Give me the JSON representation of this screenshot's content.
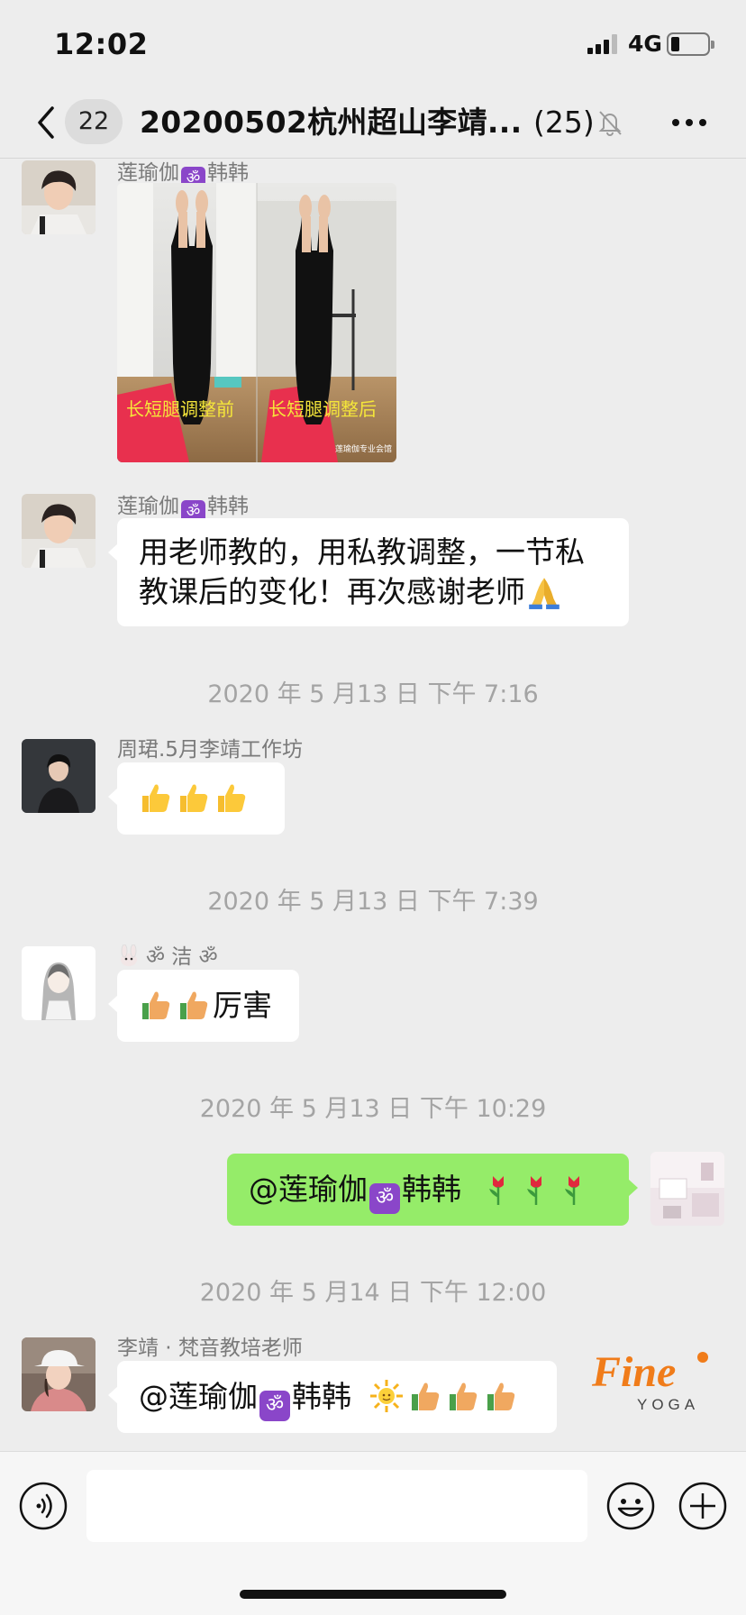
{
  "status_bar": {
    "time": "12:02",
    "network": "4G",
    "battery_level": 0.15
  },
  "nav": {
    "back_icon": "chevron-left-icon",
    "unread_count": "22",
    "title": "20200502杭州超山李靖...",
    "member_count": "(25)",
    "mute_icon": "bell-slash-icon",
    "more_icon": "ellipsis-icon"
  },
  "messages": [
    {
      "sender": "莲瑜伽 ☸ 韩韩",
      "sender_name_pre": "莲瑜伽",
      "sender_name_post": "韩韩",
      "type": "image",
      "image_caption_left": "长短腿调整前",
      "image_caption_right": "长短腿调整后",
      "image_watermark": "莲瑜伽专业会馆"
    },
    {
      "sender_name_pre": "莲瑜伽",
      "sender_name_post": "韩韩",
      "type": "text",
      "text_line1": "用老师教的，用私教调整，一节私",
      "text_line2": "教课后的变化！再次感谢老师"
    },
    {
      "timestamp": "2020 年 5 月13 日  下午 7:16"
    },
    {
      "sender": "周珺.5月李靖工作坊",
      "type": "text",
      "emoji": [
        "thumbs-up-icon",
        "thumbs-up-icon",
        "thumbs-up-icon"
      ]
    },
    {
      "timestamp": "2020 年 5 月13 日  下午 7:39"
    },
    {
      "sender": "ॐ 洁 ॐ",
      "type": "text",
      "text": "厉害"
    },
    {
      "timestamp": "2020 年 5 月13 日  下午 10:29"
    },
    {
      "type": "text",
      "outgoing": true,
      "text_pre": "@莲瑜伽",
      "text_post": "韩韩"
    },
    {
      "timestamp": "2020 年 5 月14 日  下午 12:00"
    },
    {
      "sender": "李靖 · 梵音教培老师",
      "type": "text",
      "text_pre": "@莲瑜伽",
      "text_post": "韩韩"
    }
  ],
  "om_symbol": "ॐ",
  "watermark": {
    "brand": "Fine",
    "sub": "YOGA"
  },
  "input_bar": {
    "voice_icon": "voice-icon",
    "emoji_icon": "smiley-icon",
    "plus_icon": "plus-circle-icon"
  },
  "colors": {
    "background": "#ededed",
    "outgoing_bubble": "#95ec69",
    "incoming_bubble": "#ffffff",
    "om_badge": "#8a46c9",
    "watermark_orange": "#f07c1a"
  }
}
